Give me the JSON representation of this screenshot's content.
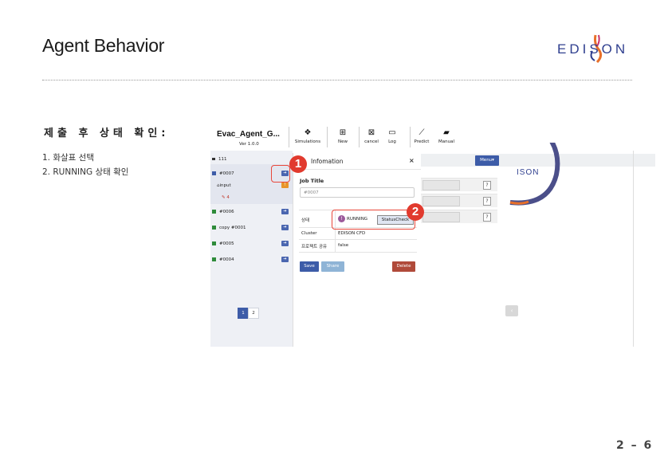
{
  "slide": {
    "title": "Agent Behavior",
    "logo_text": "EDISON",
    "section_title": "제출 후 상태 확인:",
    "steps": [
      "1. 화살표 선택",
      "2. RUNNING 상태 확인"
    ],
    "page_number": "2 – 6"
  },
  "app": {
    "name": "Evac_Agent_G...",
    "version": "Ver 1.0.0",
    "toolbar": [
      {
        "label": "Simulations",
        "icon": "simulations-icon"
      },
      {
        "label": "New",
        "icon": "new-icon"
      },
      {
        "label": "cancel",
        "icon": "cancel-icon"
      },
      {
        "label": "Log",
        "icon": "log-icon"
      },
      {
        "label": "Predict",
        "icon": "predict-icon"
      },
      {
        "label": "Manual",
        "icon": "manual-icon"
      }
    ],
    "tree": {
      "root": "111",
      "jobs": [
        "#0007",
        "input",
        "4",
        "#0006",
        "copy #0001",
        "#0005",
        "#0004"
      ]
    },
    "pager": [
      "1",
      "2"
    ],
    "modal": {
      "title": "Infomation",
      "close": "×",
      "job_title_label": "Job Title",
      "job_title_value": "#0007",
      "rows": {
        "status_key": "상태",
        "status_value": "RUNNING",
        "status_button": "StatusCheck",
        "cluster_key": "Cluster",
        "cluster_value": "EDISON CFD",
        "share_key": "프로젝트 공유",
        "share_value": "false"
      },
      "save": "Save",
      "share": "Share",
      "delete": "Delete"
    },
    "menu_button": "Menu▾",
    "help": "?"
  },
  "annotations": [
    "1",
    "2"
  ],
  "colors": {
    "accent": "#3d5ca8",
    "badge": "#e13a2e",
    "delete": "#b04a3a"
  }
}
